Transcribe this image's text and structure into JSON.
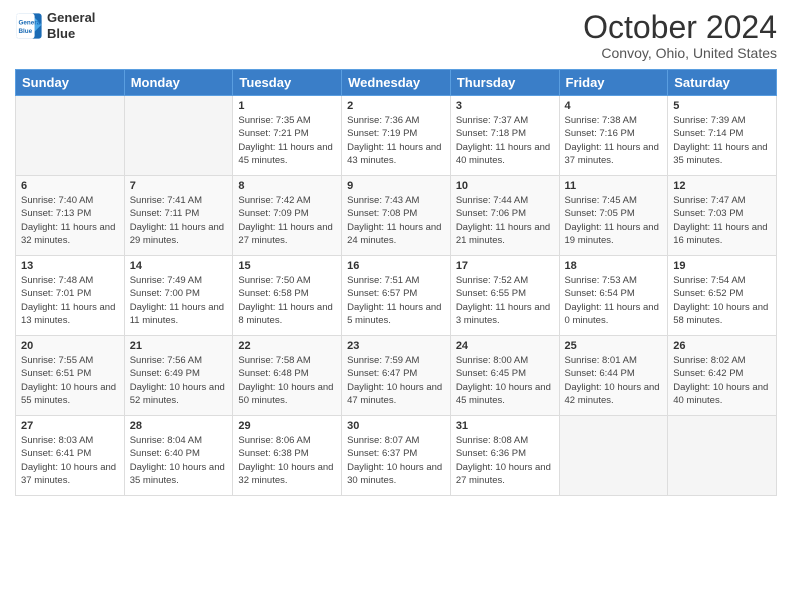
{
  "logo": {
    "line1": "General",
    "line2": "Blue"
  },
  "title": "October 2024",
  "subtitle": "Convoy, Ohio, United States",
  "days_of_week": [
    "Sunday",
    "Monday",
    "Tuesday",
    "Wednesday",
    "Thursday",
    "Friday",
    "Saturday"
  ],
  "weeks": [
    [
      {
        "num": "",
        "detail": ""
      },
      {
        "num": "",
        "detail": ""
      },
      {
        "num": "1",
        "detail": "Sunrise: 7:35 AM\nSunset: 7:21 PM\nDaylight: 11 hours and 45 minutes."
      },
      {
        "num": "2",
        "detail": "Sunrise: 7:36 AM\nSunset: 7:19 PM\nDaylight: 11 hours and 43 minutes."
      },
      {
        "num": "3",
        "detail": "Sunrise: 7:37 AM\nSunset: 7:18 PM\nDaylight: 11 hours and 40 minutes."
      },
      {
        "num": "4",
        "detail": "Sunrise: 7:38 AM\nSunset: 7:16 PM\nDaylight: 11 hours and 37 minutes."
      },
      {
        "num": "5",
        "detail": "Sunrise: 7:39 AM\nSunset: 7:14 PM\nDaylight: 11 hours and 35 minutes."
      }
    ],
    [
      {
        "num": "6",
        "detail": "Sunrise: 7:40 AM\nSunset: 7:13 PM\nDaylight: 11 hours and 32 minutes."
      },
      {
        "num": "7",
        "detail": "Sunrise: 7:41 AM\nSunset: 7:11 PM\nDaylight: 11 hours and 29 minutes."
      },
      {
        "num": "8",
        "detail": "Sunrise: 7:42 AM\nSunset: 7:09 PM\nDaylight: 11 hours and 27 minutes."
      },
      {
        "num": "9",
        "detail": "Sunrise: 7:43 AM\nSunset: 7:08 PM\nDaylight: 11 hours and 24 minutes."
      },
      {
        "num": "10",
        "detail": "Sunrise: 7:44 AM\nSunset: 7:06 PM\nDaylight: 11 hours and 21 minutes."
      },
      {
        "num": "11",
        "detail": "Sunrise: 7:45 AM\nSunset: 7:05 PM\nDaylight: 11 hours and 19 minutes."
      },
      {
        "num": "12",
        "detail": "Sunrise: 7:47 AM\nSunset: 7:03 PM\nDaylight: 11 hours and 16 minutes."
      }
    ],
    [
      {
        "num": "13",
        "detail": "Sunrise: 7:48 AM\nSunset: 7:01 PM\nDaylight: 11 hours and 13 minutes."
      },
      {
        "num": "14",
        "detail": "Sunrise: 7:49 AM\nSunset: 7:00 PM\nDaylight: 11 hours and 11 minutes."
      },
      {
        "num": "15",
        "detail": "Sunrise: 7:50 AM\nSunset: 6:58 PM\nDaylight: 11 hours and 8 minutes."
      },
      {
        "num": "16",
        "detail": "Sunrise: 7:51 AM\nSunset: 6:57 PM\nDaylight: 11 hours and 5 minutes."
      },
      {
        "num": "17",
        "detail": "Sunrise: 7:52 AM\nSunset: 6:55 PM\nDaylight: 11 hours and 3 minutes."
      },
      {
        "num": "18",
        "detail": "Sunrise: 7:53 AM\nSunset: 6:54 PM\nDaylight: 11 hours and 0 minutes."
      },
      {
        "num": "19",
        "detail": "Sunrise: 7:54 AM\nSunset: 6:52 PM\nDaylight: 10 hours and 58 minutes."
      }
    ],
    [
      {
        "num": "20",
        "detail": "Sunrise: 7:55 AM\nSunset: 6:51 PM\nDaylight: 10 hours and 55 minutes."
      },
      {
        "num": "21",
        "detail": "Sunrise: 7:56 AM\nSunset: 6:49 PM\nDaylight: 10 hours and 52 minutes."
      },
      {
        "num": "22",
        "detail": "Sunrise: 7:58 AM\nSunset: 6:48 PM\nDaylight: 10 hours and 50 minutes."
      },
      {
        "num": "23",
        "detail": "Sunrise: 7:59 AM\nSunset: 6:47 PM\nDaylight: 10 hours and 47 minutes."
      },
      {
        "num": "24",
        "detail": "Sunrise: 8:00 AM\nSunset: 6:45 PM\nDaylight: 10 hours and 45 minutes."
      },
      {
        "num": "25",
        "detail": "Sunrise: 8:01 AM\nSunset: 6:44 PM\nDaylight: 10 hours and 42 minutes."
      },
      {
        "num": "26",
        "detail": "Sunrise: 8:02 AM\nSunset: 6:42 PM\nDaylight: 10 hours and 40 minutes."
      }
    ],
    [
      {
        "num": "27",
        "detail": "Sunrise: 8:03 AM\nSunset: 6:41 PM\nDaylight: 10 hours and 37 minutes."
      },
      {
        "num": "28",
        "detail": "Sunrise: 8:04 AM\nSunset: 6:40 PM\nDaylight: 10 hours and 35 minutes."
      },
      {
        "num": "29",
        "detail": "Sunrise: 8:06 AM\nSunset: 6:38 PM\nDaylight: 10 hours and 32 minutes."
      },
      {
        "num": "30",
        "detail": "Sunrise: 8:07 AM\nSunset: 6:37 PM\nDaylight: 10 hours and 30 minutes."
      },
      {
        "num": "31",
        "detail": "Sunrise: 8:08 AM\nSunset: 6:36 PM\nDaylight: 10 hours and 27 minutes."
      },
      {
        "num": "",
        "detail": ""
      },
      {
        "num": "",
        "detail": ""
      }
    ]
  ]
}
